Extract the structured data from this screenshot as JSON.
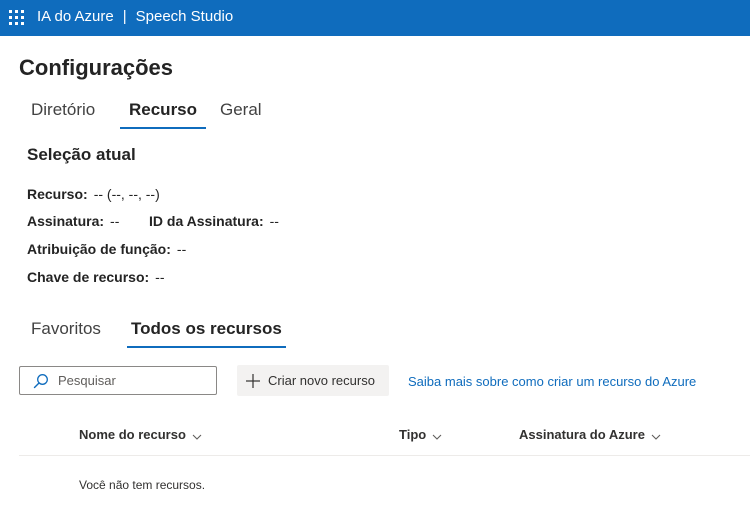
{
  "header": {
    "product": "IA do Azure",
    "separator": "|",
    "app": "Speech Studio"
  },
  "page": {
    "title": "Configurações"
  },
  "settings_tabs": [
    {
      "label": "Diretório",
      "active": false
    },
    {
      "label": "Recurso",
      "active": true
    },
    {
      "label": "Geral",
      "active": false
    }
  ],
  "current_selection": {
    "title": "Seleção atual",
    "resource_label": "Recurso:",
    "resource_value": "-- (--, --, --)",
    "subscription_label": "Assinatura:",
    "subscription_value": "--",
    "subscription_id_label": "ID da Assinatura:",
    "subscription_id_value": "--",
    "role_label": "Atribuição de função:",
    "role_value": "--",
    "key_label": "Chave de recurso:",
    "key_value": "--"
  },
  "resource_tabs": [
    {
      "label": "Favoritos",
      "active": false
    },
    {
      "label": "Todos os recursos",
      "active": true
    }
  ],
  "toolbar": {
    "search_placeholder": "Pesquisar",
    "search_value": "",
    "new_resource_label": "Criar novo recurso",
    "learn_more_link": "Saiba mais sobre como criar um recurso do Azure"
  },
  "table": {
    "columns": [
      "Nome do recurso",
      "Tipo",
      "Assinatura do Azure"
    ],
    "rows": [],
    "empty_message": "Você não tem recursos."
  },
  "colors": {
    "brand_blue": "#0f6cbd",
    "button_bg": "#f3f2f1"
  }
}
